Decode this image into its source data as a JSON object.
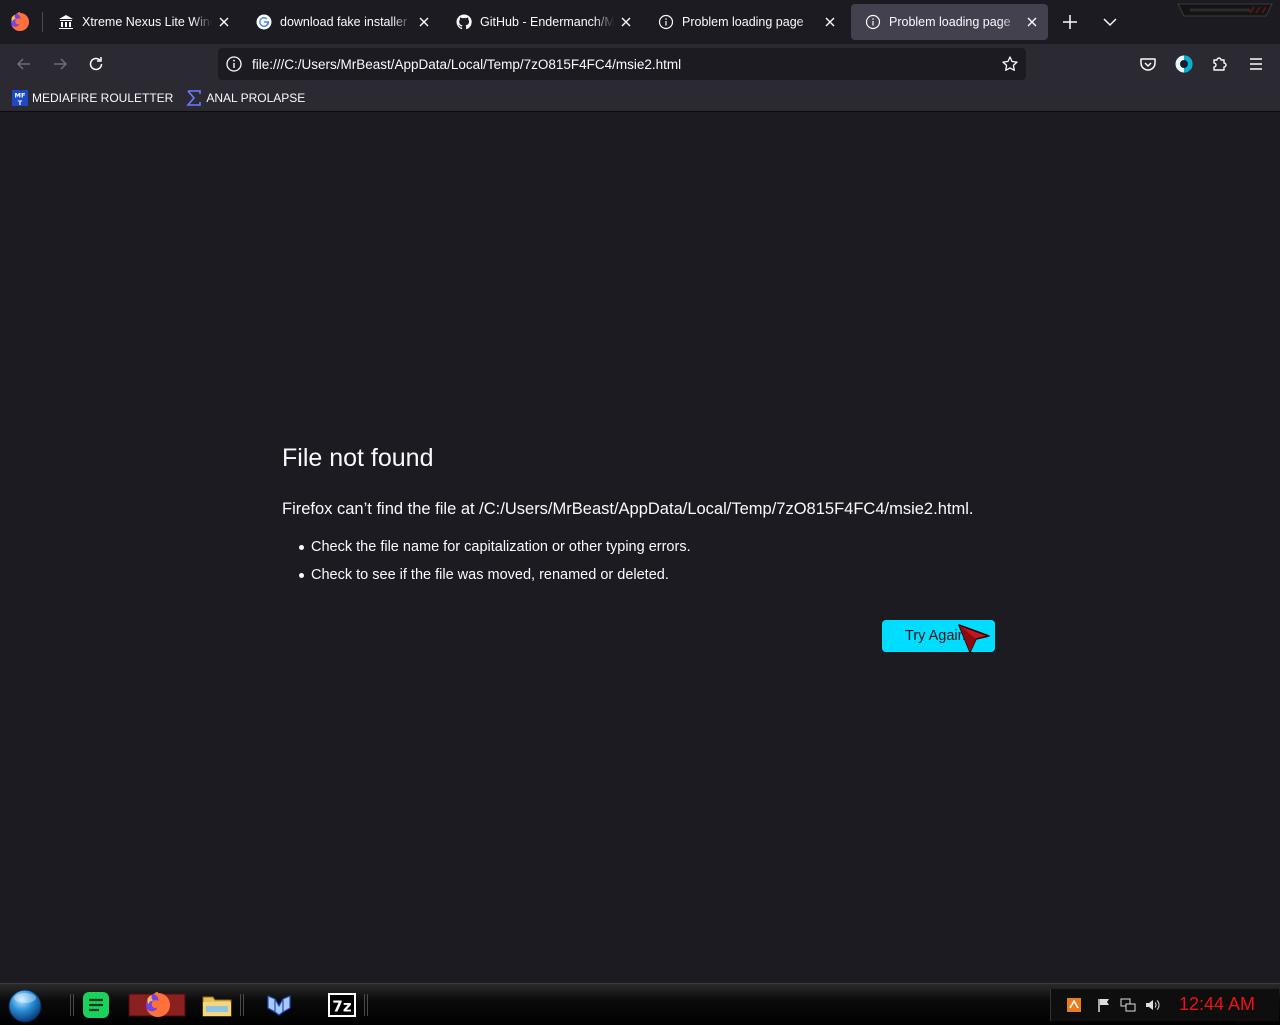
{
  "browser": {
    "tabs": [
      {
        "title": "Xtreme Nexus Lite Windows",
        "icon": "museum-icon",
        "active": false
      },
      {
        "title": "download fake installer - Google",
        "icon": "google-icon",
        "active": false
      },
      {
        "title": "GitHub - Endermanch/MalwareDatabase",
        "icon": "github-icon",
        "active": false
      },
      {
        "title": "Problem loading page",
        "icon": "info-icon",
        "active": false
      },
      {
        "title": "Problem loading page",
        "icon": "info-icon",
        "active": true
      }
    ],
    "url": "file:///C:/Users/MrBeast/AppData/Local/Temp/7zO815F4FC4/msie2.html",
    "bookmarks": [
      {
        "label": "MEDIAFIRE ROULETTER",
        "icon": "mediafire-icon"
      },
      {
        "label": "ANAL PROLAPSE",
        "icon": "sigma-icon"
      }
    ],
    "accent_color": "#00ddff"
  },
  "error_page": {
    "title": "File not found",
    "description": "Firefox can’t find the file at /C:/Users/MrBeast/AppData/Local/Temp/7zO815F4FC4/msie2.html.",
    "suggestions": [
      "Check the file name for capitalization or other typing errors.",
      "Check to see if the file was moved, renamed or deleted."
    ],
    "button_label": "Try Again"
  },
  "taskbar": {
    "apps": [
      "start-orb",
      "notes-app-icon",
      "firefox-icon",
      "file-explorer-icon",
      "malwarebytes-icon",
      "7zip-icon"
    ],
    "app_7z_label": "7z",
    "clock": "12:44 AM",
    "clock_color": "#ee1111"
  }
}
